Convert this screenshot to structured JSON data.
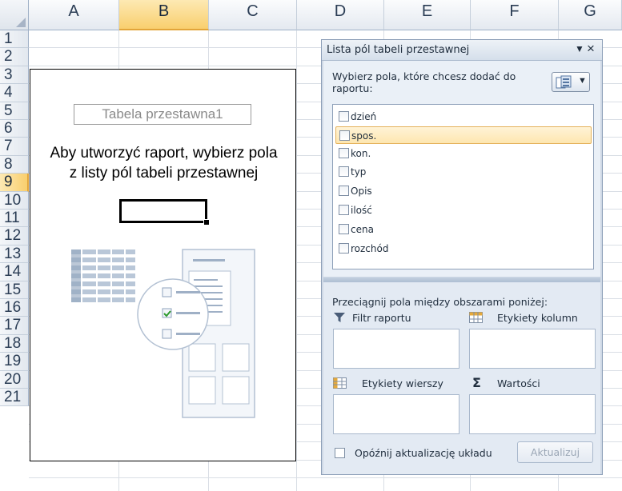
{
  "sheet": {
    "columns": [
      {
        "label": "A",
        "selected": false
      },
      {
        "label": "B",
        "selected": true
      },
      {
        "label": "C",
        "selected": false
      },
      {
        "label": "D",
        "selected": false
      },
      {
        "label": "E",
        "selected": false
      },
      {
        "label": "F",
        "selected": false
      },
      {
        "label": "G",
        "selected": false
      }
    ],
    "rows": [
      "1",
      "2",
      "3",
      "4",
      "5",
      "6",
      "7",
      "8",
      "9",
      "10",
      "11",
      "12",
      "13",
      "14",
      "15",
      "16",
      "17",
      "18",
      "19",
      "20",
      "21"
    ],
    "selected_row": "9"
  },
  "pivot": {
    "name": "Tabela przestawna1",
    "message_line1": "Aby utworzyć raport, wybierz pola",
    "message_line2": "z listy pól tabeli przestawnej"
  },
  "panel": {
    "title": "Lista pól tabeli przestawnej",
    "menu_icon": "dropdown-arrow-icon",
    "close_icon": "close-icon",
    "choose_label": "Wybierz pola, które chcesz dodać do raportu:",
    "layout_button_icon": "field-list-layout-icon",
    "fields": [
      {
        "label": "dzień",
        "checked": false,
        "highlighted": false
      },
      {
        "label": "spos.",
        "checked": false,
        "highlighted": true
      },
      {
        "label": "kon.",
        "checked": false,
        "highlighted": false
      },
      {
        "label": "typ",
        "checked": false,
        "highlighted": false
      },
      {
        "label": "Opis",
        "checked": false,
        "highlighted": false
      },
      {
        "label": "ilość",
        "checked": false,
        "highlighted": false
      },
      {
        "label": "cena",
        "checked": false,
        "highlighted": false
      },
      {
        "label": "rozchód",
        "checked": false,
        "highlighted": false
      }
    ],
    "drag_label": "Przeciągnij pola między obszarami poniżej:",
    "areas": {
      "filter": "Filtr raportu",
      "columns": "Etykiety kolumn",
      "rows": "Etykiety wierszy",
      "values": "Wartości"
    },
    "sigma": "Σ",
    "defer_label": "Opóźnij aktualizację układu",
    "update_label": "Aktualizuj",
    "colors": {
      "accent": "#f9cf6e",
      "panel_bg": "#cfd9e6",
      "highlight": "#fde6b0"
    }
  }
}
